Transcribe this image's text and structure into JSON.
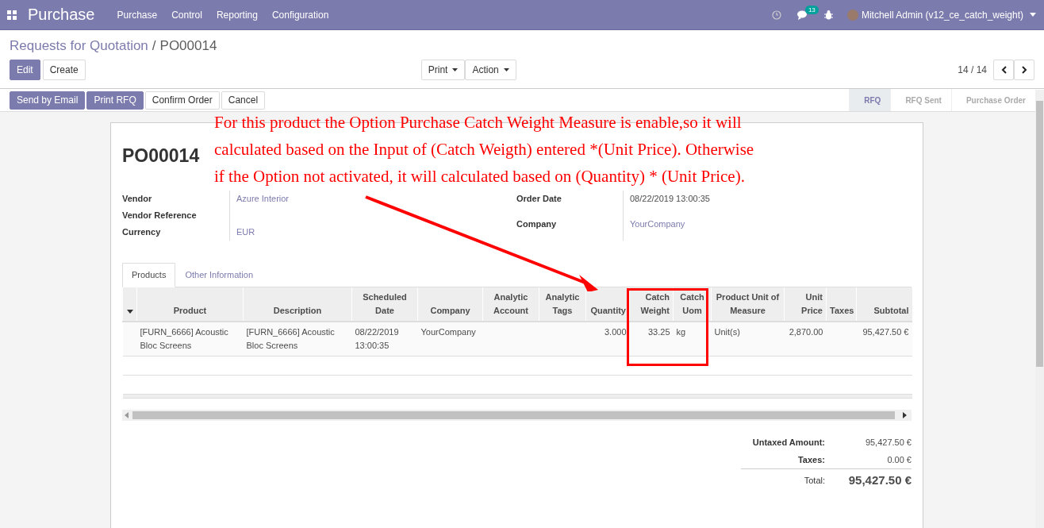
{
  "navbar": {
    "app_title": "Purchase",
    "menu": [
      "Purchase",
      "Control",
      "Reporting",
      "Configuration"
    ],
    "message_count": "13",
    "user": "Mitchell Admin (v12_ce_catch_weight)"
  },
  "breadcrumb": {
    "parent": "Requests for Quotation",
    "separator": "/",
    "current": "PO00014"
  },
  "buttons": {
    "primary": [
      "Edit"
    ],
    "secondary": [
      "Create"
    ],
    "dropdowns": [
      "Print",
      "Action"
    ]
  },
  "pager": {
    "value": "14 / 14"
  },
  "header_buttons": [
    {
      "label": "Send by Email",
      "kind": "primary"
    },
    {
      "label": "Print RFQ",
      "kind": "primary"
    },
    {
      "label": "Confirm Order",
      "kind": "secondary"
    },
    {
      "label": "Cancel",
      "kind": "secondary"
    }
  ],
  "stages": [
    {
      "label": "RFQ",
      "selected": true
    },
    {
      "label": "RFQ Sent",
      "selected": false
    },
    {
      "label": "Purchase Order",
      "selected": false
    }
  ],
  "annotation": {
    "lines": [
      "For this product the Option Purchase Catch Weight Measure is enable,so it will",
      "calculated based on the Input of (Catch Weigth) entered *(Unit Price). Otherwise",
      "if the Option not activated, it will calculated based on (Quantity) * (Unit Price)."
    ]
  },
  "sheet": {
    "title": "PO00014",
    "left_fields": [
      {
        "label": "Vendor",
        "value": "Azure Interior",
        "kind": "link"
      },
      {
        "label": "Vendor Reference"
      },
      {
        "label": "Currency",
        "value": "EUR",
        "kind": "link"
      }
    ],
    "right_fields": [
      {
        "label": "Order Date",
        "value": "08/22/2019 13:00:35",
        "kind": "text"
      },
      {
        "label": "Company",
        "value": "YourCompany",
        "kind": "link"
      }
    ],
    "tabs": [
      {
        "label": "Products",
        "selected": true
      },
      {
        "label": "Other Information",
        "selected": false
      }
    ],
    "table": {
      "columns": [
        "Product",
        "Description",
        "Scheduled Date",
        "Company",
        "Analytic Account",
        "Analytic Tags",
        "Quantity",
        "Catch Weight",
        "Catch Uom",
        "Product Unit of Measure",
        "Unit Price",
        "Taxes",
        "Subtotal"
      ],
      "rows": [
        [
          "[FURN_6666] Acoustic Bloc Screens",
          "[FURN_6666] Acoustic Bloc Screens",
          "08/22/2019 13:00:35",
          "YourCompany",
          "",
          "",
          "3.000",
          "33.25",
          "kg",
          "Unit(s)",
          "2,870.00",
          "",
          "95,427.50 €"
        ]
      ]
    },
    "totals": [
      {
        "label": "Untaxed Amount:",
        "value": "95,427.50 €",
        "kind": "line"
      },
      {
        "label": "Taxes:",
        "value": "0.00 €",
        "kind": "line"
      },
      {
        "label": "Total:",
        "value": "95,427.50 €",
        "kind": "total"
      }
    ]
  }
}
